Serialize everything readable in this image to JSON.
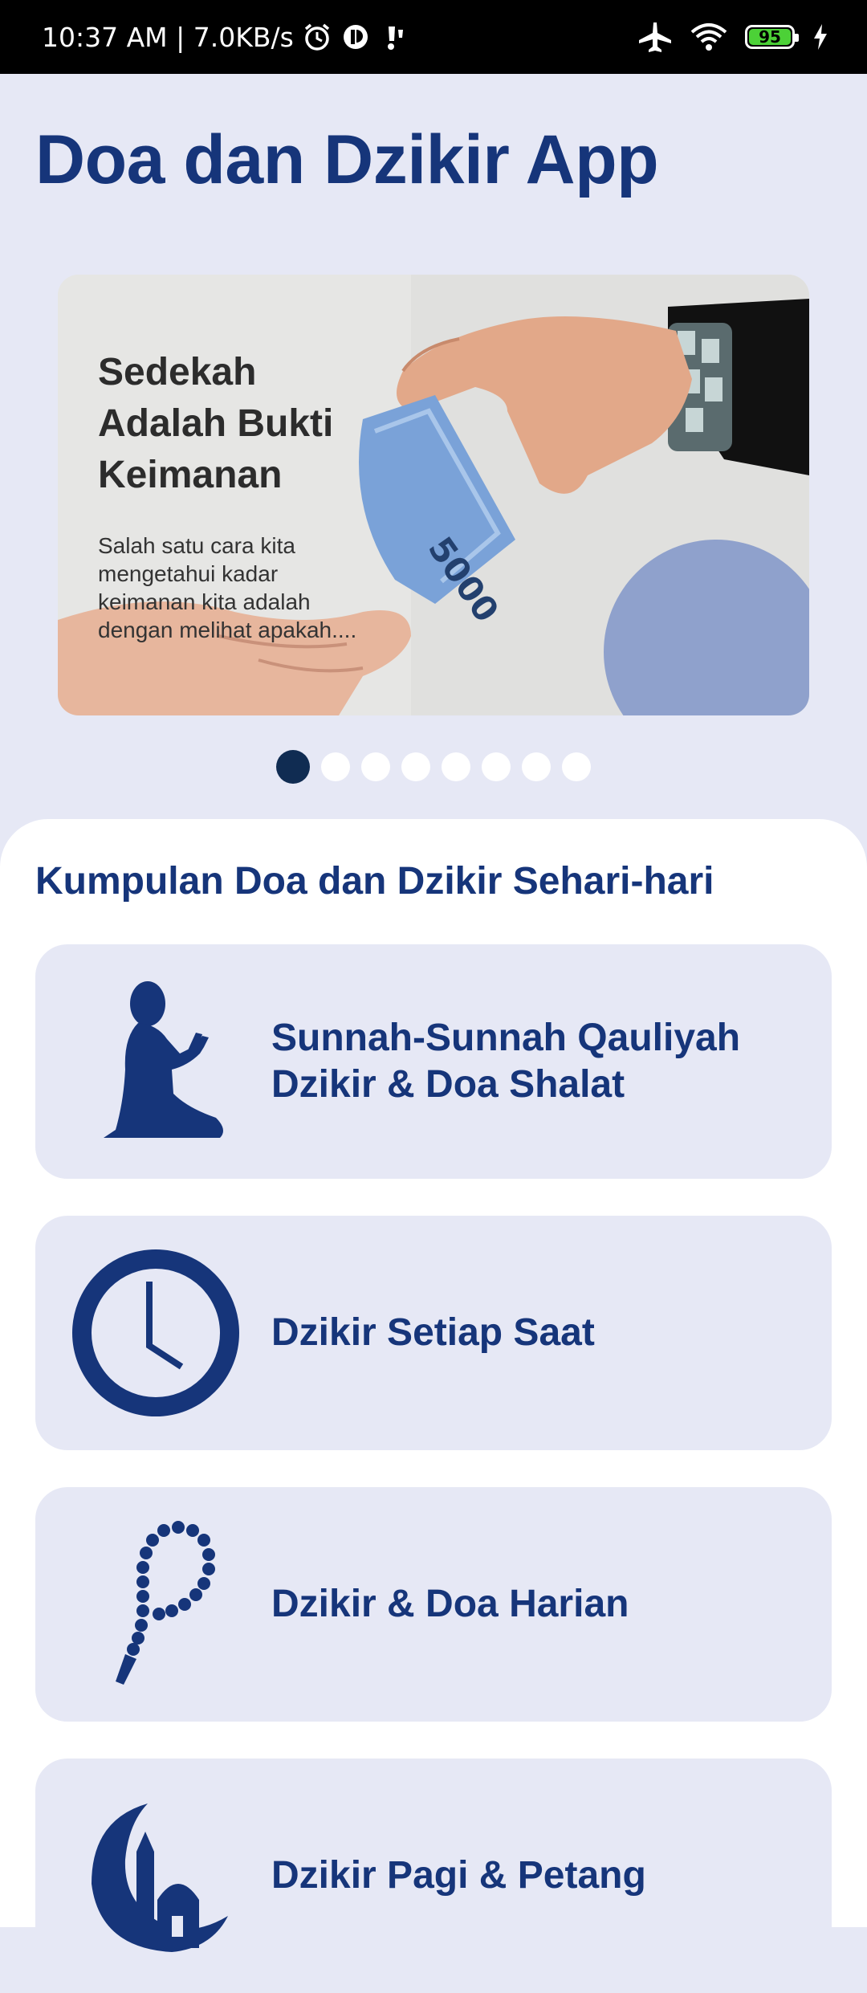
{
  "status_bar": {
    "time_speed": "10:37 AM | 7.0KB/s",
    "battery": "95",
    "icons_left": [
      "alarm-icon",
      "notification-icon",
      "sim-icon"
    ],
    "icons_right": [
      "airplane-icon",
      "wifi-icon",
      "battery-icon",
      "charging-icon"
    ]
  },
  "app": {
    "title": "Doa dan Dzikir App"
  },
  "banner": {
    "heading": "Sedekah\nAdalah Bukti\nKeimanan",
    "body": "Salah satu cara kita\nmengetahui kadar\nkeimanan kita adalah\ndengan melihat apakah....",
    "banknote_text": "5000",
    "slide_count": 8,
    "active_slide": 1
  },
  "section": {
    "title": "Kumpulan Doa dan Dzikir Sehari-hari"
  },
  "menu": [
    {
      "label": "Sunnah-Sunnah Qauliyah\nDzikir & Doa Shalat",
      "icon": "praying-person-icon"
    },
    {
      "label": "Dzikir Setiap Saat",
      "icon": "clock-icon"
    },
    {
      "label": "Dzikir & Doa Harian",
      "icon": "prayer-beads-icon"
    },
    {
      "label": "Dzikir Pagi & Petang",
      "icon": "crescent-mosque-icon"
    }
  ],
  "colors": {
    "primary": "#16357a",
    "background": "#e6e8f5",
    "card": "#e6e8f5",
    "dot_active": "#102c52"
  }
}
